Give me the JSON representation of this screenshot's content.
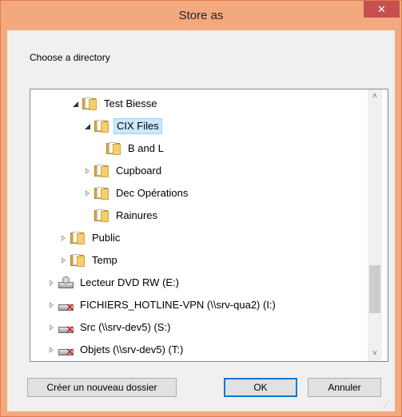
{
  "window": {
    "title": "Store as",
    "close_glyph": "✕"
  },
  "dialog": {
    "prompt": "Choose a directory"
  },
  "tree": {
    "items": [
      {
        "label": "Test Biesse",
        "icon": "folder-icon",
        "expander": "expanded"
      },
      {
        "label": "CIX Files",
        "icon": "folder-icon",
        "expander": "expanded",
        "selected": true
      },
      {
        "label": "B and L",
        "icon": "folder-icon",
        "expander": "none"
      },
      {
        "label": "Cupboard",
        "icon": "folder-icon",
        "expander": "collapsed"
      },
      {
        "label": "Dec Opérations",
        "icon": "folder-icon",
        "expander": "collapsed"
      },
      {
        "label": "Rainures",
        "icon": "folder-icon",
        "expander": "none"
      },
      {
        "label": "Public",
        "icon": "folder-icon",
        "expander": "collapsed"
      },
      {
        "label": "Temp",
        "icon": "folder-icon",
        "expander": "collapsed"
      },
      {
        "label": "Lecteur DVD RW (E:)",
        "icon": "dvd-drive-icon",
        "expander": "collapsed"
      },
      {
        "label": "FICHIERS_HOTLINE-VPN (\\\\srv-qua2) (I:)",
        "icon": "disconnected-network-drive-icon",
        "expander": "collapsed"
      },
      {
        "label": "Src (\\\\srv-dev5) (S:)",
        "icon": "disconnected-network-drive-icon",
        "expander": "collapsed"
      },
      {
        "label": "Objets (\\\\srv-dev5) (T:)",
        "icon": "disconnected-network-drive-icon",
        "expander": "collapsed"
      }
    ]
  },
  "scrollbar": {
    "up_glyph": "˄",
    "down_glyph": "˅"
  },
  "buttons": {
    "new_folder": "Créer un nouveau dossier",
    "ok": "OK",
    "cancel": "Annuler"
  },
  "colors": {
    "title_bar": "#f3a97e",
    "close_button": "#c74f4f",
    "selection": "#cce8ff",
    "default_button_border": "#0078d7"
  }
}
